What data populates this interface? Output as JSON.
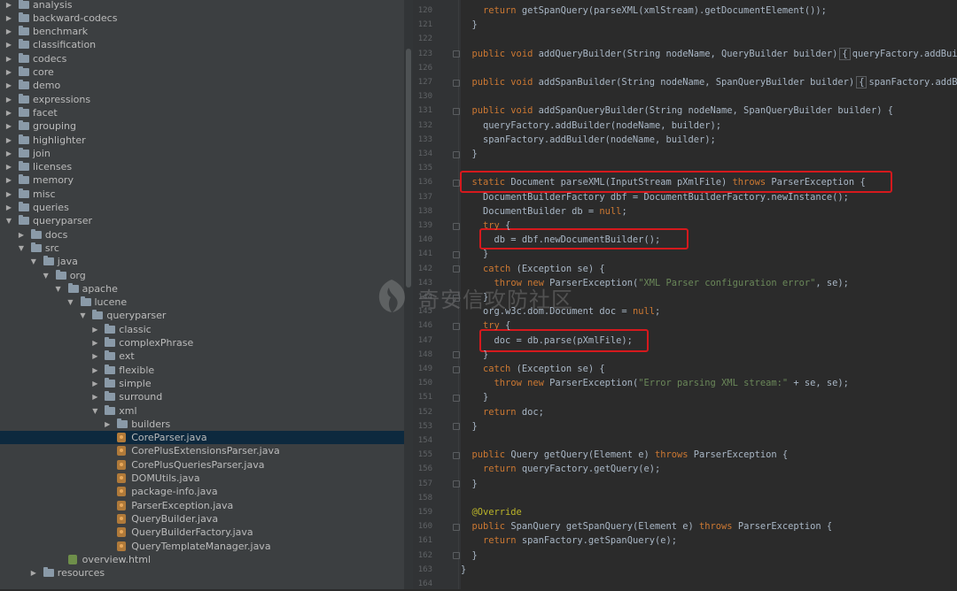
{
  "project_tree": {
    "items": [
      {
        "label": "analysis",
        "type": "folder",
        "depth": 0,
        "expanded": false
      },
      {
        "label": "backward-codecs",
        "type": "folder",
        "depth": 0,
        "expanded": false
      },
      {
        "label": "benchmark",
        "type": "folder",
        "depth": 0,
        "expanded": false
      },
      {
        "label": "classification",
        "type": "folder",
        "depth": 0,
        "expanded": false
      },
      {
        "label": "codecs",
        "type": "folder",
        "depth": 0,
        "expanded": false
      },
      {
        "label": "core",
        "type": "folder",
        "depth": 0,
        "expanded": false
      },
      {
        "label": "demo",
        "type": "folder",
        "depth": 0,
        "expanded": false
      },
      {
        "label": "expressions",
        "type": "folder",
        "depth": 0,
        "expanded": false
      },
      {
        "label": "facet",
        "type": "folder",
        "depth": 0,
        "expanded": false
      },
      {
        "label": "grouping",
        "type": "folder",
        "depth": 0,
        "expanded": false
      },
      {
        "label": "highlighter",
        "type": "folder",
        "depth": 0,
        "expanded": false
      },
      {
        "label": "join",
        "type": "folder",
        "depth": 0,
        "expanded": false
      },
      {
        "label": "licenses",
        "type": "folder",
        "depth": 0,
        "expanded": false
      },
      {
        "label": "memory",
        "type": "folder",
        "depth": 0,
        "expanded": false
      },
      {
        "label": "misc",
        "type": "folder",
        "depth": 0,
        "expanded": false
      },
      {
        "label": "queries",
        "type": "folder",
        "depth": 0,
        "expanded": false
      },
      {
        "label": "queryparser",
        "type": "folder",
        "depth": 0,
        "expanded": true
      },
      {
        "label": "docs",
        "type": "folder",
        "depth": 1,
        "expanded": false
      },
      {
        "label": "src",
        "type": "folder",
        "depth": 1,
        "expanded": true
      },
      {
        "label": "java",
        "type": "folder",
        "depth": 2,
        "expanded": true
      },
      {
        "label": "org",
        "type": "folder",
        "depth": 3,
        "expanded": true
      },
      {
        "label": "apache",
        "type": "folder",
        "depth": 4,
        "expanded": true
      },
      {
        "label": "lucene",
        "type": "folder",
        "depth": 5,
        "expanded": true
      },
      {
        "label": "queryparser",
        "type": "folder",
        "depth": 6,
        "expanded": true
      },
      {
        "label": "classic",
        "type": "folder",
        "depth": 7,
        "expanded": false
      },
      {
        "label": "complexPhrase",
        "type": "folder",
        "depth": 7,
        "expanded": false
      },
      {
        "label": "ext",
        "type": "folder",
        "depth": 7,
        "expanded": false
      },
      {
        "label": "flexible",
        "type": "folder",
        "depth": 7,
        "expanded": false
      },
      {
        "label": "simple",
        "type": "folder",
        "depth": 7,
        "expanded": false
      },
      {
        "label": "surround",
        "type": "folder",
        "depth": 7,
        "expanded": false
      },
      {
        "label": "xml",
        "type": "folder",
        "depth": 7,
        "expanded": true
      },
      {
        "label": "builders",
        "type": "folder",
        "depth": 8,
        "expanded": false
      },
      {
        "label": "CoreParser.java",
        "type": "java",
        "depth": 8,
        "selected": true
      },
      {
        "label": "CorePlusExtensionsParser.java",
        "type": "java",
        "depth": 8
      },
      {
        "label": "CorePlusQueriesParser.java",
        "type": "java",
        "depth": 8
      },
      {
        "label": "DOMUtils.java",
        "type": "java",
        "depth": 8
      },
      {
        "label": "package-info.java",
        "type": "java",
        "depth": 8
      },
      {
        "label": "ParserException.java",
        "type": "java",
        "depth": 8
      },
      {
        "label": "QueryBuilder.java",
        "type": "java",
        "depth": 8
      },
      {
        "label": "QueryBuilderFactory.java",
        "type": "java",
        "depth": 8
      },
      {
        "label": "QueryTemplateManager.java",
        "type": "java",
        "depth": 8
      },
      {
        "label": "overview.html",
        "type": "html",
        "depth": 4
      },
      {
        "label": "resources",
        "type": "folder",
        "depth": 2,
        "expanded": false
      }
    ]
  },
  "editor": {
    "lines": [
      {
        "n": "120",
        "segs": [
          [
            "    "
          ],
          [
            "return",
            "kw"
          ],
          [
            " getSpanQuery(parseXML(xmlStream).getDocumentElement());"
          ]
        ]
      },
      {
        "n": "121",
        "segs": [
          [
            "  }"
          ]
        ]
      },
      {
        "n": "122",
        "segs": [
          [
            ""
          ]
        ]
      },
      {
        "n": "123",
        "segs": [
          [
            "  "
          ],
          [
            "public void",
            "kw"
          ],
          [
            " addQueryBuilder(String nodeName, QueryBuilder builder)"
          ],
          [
            "{",
            "fb"
          ],
          [
            "queryFactory.addBuild"
          ]
        ]
      },
      {
        "n": "126",
        "segs": [
          [
            ""
          ]
        ]
      },
      {
        "n": "127",
        "segs": [
          [
            "  "
          ],
          [
            "public void",
            "kw"
          ],
          [
            " addSpanBuilder(String nodeName, SpanQueryBuilder builder)"
          ],
          [
            "{",
            "fb"
          ],
          [
            "spanFactory.addBuil"
          ]
        ]
      },
      {
        "n": "130",
        "segs": [
          [
            ""
          ]
        ]
      },
      {
        "n": "131",
        "segs": [
          [
            "  "
          ],
          [
            "public void",
            "kw"
          ],
          [
            " addSpanQueryBuilder(String nodeName, SpanQueryBuilder builder) {"
          ]
        ]
      },
      {
        "n": "132",
        "segs": [
          [
            "    queryFactory.addBuilder(nodeName, builder);"
          ]
        ]
      },
      {
        "n": "133",
        "segs": [
          [
            "    spanFactory.addBuilder(nodeName, builder);"
          ]
        ]
      },
      {
        "n": "134",
        "segs": [
          [
            "  }"
          ]
        ]
      },
      {
        "n": "135",
        "segs": [
          [
            ""
          ]
        ]
      },
      {
        "n": "136",
        "segs": [
          [
            "  "
          ],
          [
            "static",
            "kw"
          ],
          [
            " Document parseXML(InputStream pXmlFile) "
          ],
          [
            "throws",
            "kw"
          ],
          [
            " ParserException {"
          ]
        ]
      },
      {
        "n": "137",
        "segs": [
          [
            "    DocumentBuilderFactory dbf = DocumentBuilderFactory.newInstance();"
          ]
        ]
      },
      {
        "n": "138",
        "segs": [
          [
            "    DocumentBuilder db = "
          ],
          [
            "null",
            "kw"
          ],
          [
            ";"
          ]
        ]
      },
      {
        "n": "139",
        "segs": [
          [
            "    "
          ],
          [
            "try",
            "kw"
          ],
          [
            " {"
          ]
        ]
      },
      {
        "n": "140",
        "segs": [
          [
            "      db = dbf.newDocumentBuilder();"
          ]
        ]
      },
      {
        "n": "141",
        "segs": [
          [
            "    }"
          ]
        ]
      },
      {
        "n": "142",
        "segs": [
          [
            "    "
          ],
          [
            "catch",
            "kw"
          ],
          [
            " (Exception se) {"
          ]
        ]
      },
      {
        "n": "143",
        "segs": [
          [
            "      "
          ],
          [
            "throw new",
            "kw"
          ],
          [
            " ParserException("
          ],
          [
            "\"XML Parser configuration error\"",
            "st"
          ],
          [
            ", se);"
          ]
        ]
      },
      {
        "n": "144",
        "segs": [
          [
            "    }"
          ]
        ]
      },
      {
        "n": "145",
        "segs": [
          [
            "    org.w3c.dom.Document doc = "
          ],
          [
            "null",
            "kw"
          ],
          [
            ";"
          ]
        ]
      },
      {
        "n": "146",
        "segs": [
          [
            "    "
          ],
          [
            "try",
            "kw"
          ],
          [
            " {"
          ]
        ]
      },
      {
        "n": "147",
        "segs": [
          [
            "      doc = db.parse(pXmlFile);"
          ]
        ]
      },
      {
        "n": "148",
        "segs": [
          [
            "    }"
          ]
        ]
      },
      {
        "n": "149",
        "segs": [
          [
            "    "
          ],
          [
            "catch",
            "kw"
          ],
          [
            " (Exception se) {"
          ]
        ]
      },
      {
        "n": "150",
        "segs": [
          [
            "      "
          ],
          [
            "throw new",
            "kw"
          ],
          [
            " ParserException("
          ],
          [
            "\"Error parsing XML stream:\"",
            "st"
          ],
          [
            " + se, se);"
          ]
        ]
      },
      {
        "n": "151",
        "segs": [
          [
            "    }"
          ]
        ]
      },
      {
        "n": "152",
        "segs": [
          [
            "    "
          ],
          [
            "return",
            "kw"
          ],
          [
            " doc;"
          ]
        ]
      },
      {
        "n": "153",
        "segs": [
          [
            "  }"
          ]
        ]
      },
      {
        "n": "154",
        "segs": [
          [
            ""
          ]
        ]
      },
      {
        "n": "155",
        "segs": [
          [
            "  "
          ],
          [
            "public",
            "kw"
          ],
          [
            " Query getQuery(Element e) "
          ],
          [
            "throws",
            "kw"
          ],
          [
            " ParserException {"
          ]
        ]
      },
      {
        "n": "156",
        "segs": [
          [
            "    "
          ],
          [
            "return",
            "kw"
          ],
          [
            " queryFactory.getQuery(e);"
          ]
        ]
      },
      {
        "n": "157",
        "segs": [
          [
            "  }"
          ]
        ]
      },
      {
        "n": "158",
        "segs": [
          [
            ""
          ]
        ]
      },
      {
        "n": "159",
        "segs": [
          [
            "  "
          ],
          [
            "@Override",
            "an"
          ]
        ]
      },
      {
        "n": "160",
        "segs": [
          [
            "  "
          ],
          [
            "public",
            "kw"
          ],
          [
            " SpanQuery getSpanQuery(Element e) "
          ],
          [
            "throws",
            "kw"
          ],
          [
            " ParserException {"
          ]
        ]
      },
      {
        "n": "161",
        "segs": [
          [
            "    "
          ],
          [
            "return",
            "kw"
          ],
          [
            " spanFactory.getSpanQuery(e);"
          ]
        ]
      },
      {
        "n": "162",
        "segs": [
          [
            "  }"
          ]
        ]
      },
      {
        "n": "163",
        "segs": [
          [
            "}"
          ]
        ]
      },
      {
        "n": "164",
        "segs": [
          [
            ""
          ]
        ]
      }
    ]
  },
  "watermark": {
    "text": "奇安信攻防社区"
  },
  "colors": {
    "highlight_border": "#d5191d",
    "selection": "#0d293e",
    "keyword": "#cc7832",
    "string": "#6a8759",
    "annotation": "#bbb529"
  }
}
